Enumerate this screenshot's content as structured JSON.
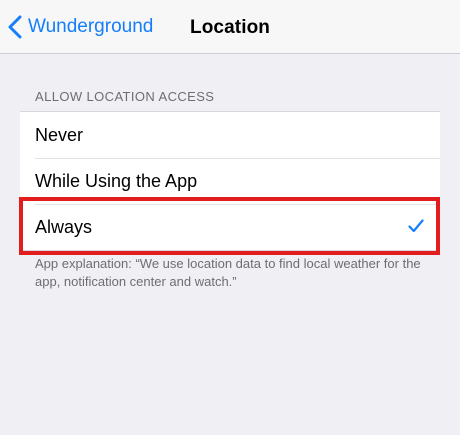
{
  "navbar": {
    "back_label": "Wunderground",
    "title": "Location"
  },
  "section": {
    "header": "ALLOW LOCATION ACCESS",
    "options": [
      {
        "label": "Never",
        "selected": false
      },
      {
        "label": "While Using the App",
        "selected": false
      },
      {
        "label": "Always",
        "selected": true
      }
    ],
    "footer": "App explanation: “We use location data to find local weather for the app, notification center and watch.”"
  },
  "colors": {
    "accent": "#147efb",
    "highlight": "#e11d1d",
    "background": "#efeff4"
  },
  "icons": {
    "back": "chevron-left-icon",
    "selected": "checkmark-icon"
  }
}
